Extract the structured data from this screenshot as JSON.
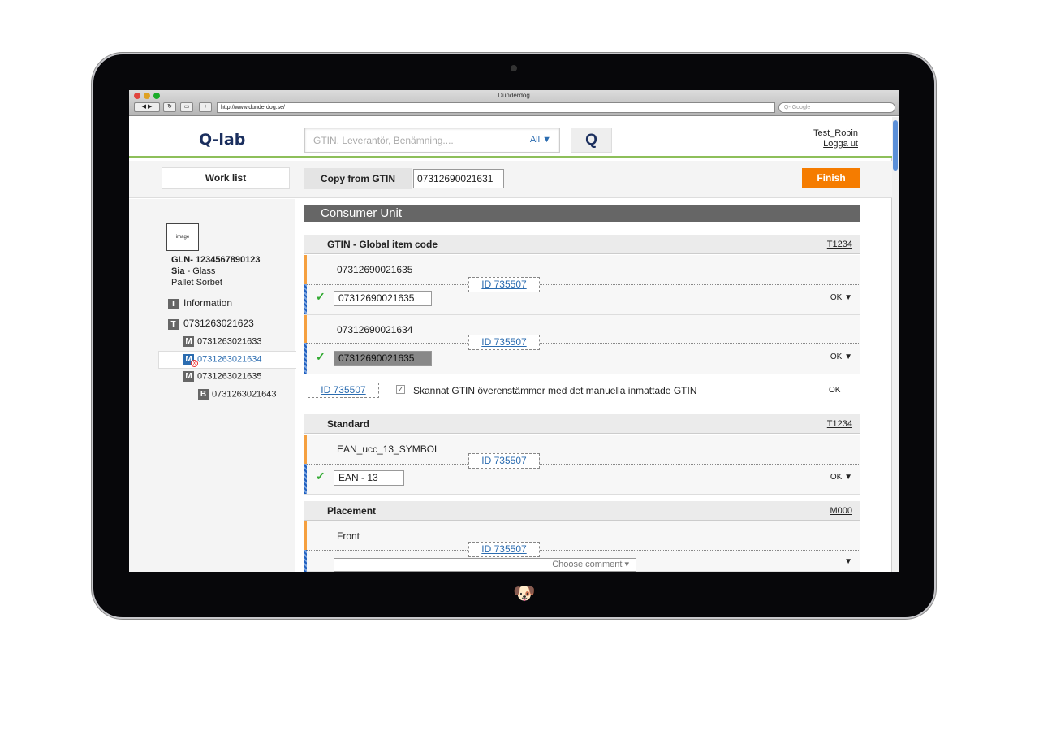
{
  "browser": {
    "title": "Dunderdog",
    "url": "http://www.dunderdog.se/",
    "search_placeholder": "Q- Google"
  },
  "header": {
    "logo": "Q-lab",
    "search_placeholder": "GTIN, Leverantör, Benämning....",
    "filter": "All ▼",
    "search_button": "Q",
    "user": "Test_Robin",
    "logout": "Logga ut"
  },
  "toolbar": {
    "worklist": "Work list",
    "copy_label": "Copy from GTIN",
    "copy_value": "07312690021631",
    "finish": "Finish"
  },
  "sidebar": {
    "image": "image",
    "gln": "GLN- 1234567890123",
    "supplier_bold": "Sia",
    "supplier_rest": " - Glass",
    "product": "Pallet Sorbet",
    "items": [
      {
        "badge": "I",
        "label": "Information"
      },
      {
        "badge": "T",
        "label": "0731263021623"
      },
      {
        "badge": "M",
        "label": "0731263021633"
      },
      {
        "badge": "M",
        "label": "0731263021634",
        "selected": true,
        "error": true
      },
      {
        "badge": "M",
        "label": "0731263021635"
      },
      {
        "badge": "B",
        "label": "0731263021643"
      }
    ]
  },
  "main": {
    "unit_title": "Consumer Unit",
    "gtin": {
      "title": "GTIN - Global item code",
      "code": "T1234",
      "rows": [
        {
          "label": "07312690021635",
          "id": "ID 735507",
          "value": "07312690021635",
          "status": "OK ▼"
        },
        {
          "label": "07312690021634",
          "id": "ID 735507",
          "value": "07312690021635",
          "status": "OK ▼"
        }
      ],
      "check": {
        "id": "ID 735507",
        "text": "Skannat GTIN överenstämmer med det manuella inmattade GTIN",
        "status": "OK",
        "checked": true
      }
    },
    "standard": {
      "title": "Standard",
      "code": "T1234",
      "label": "EAN_ucc_13_SYMBOL",
      "id": "ID 735507",
      "value": "EAN - 13",
      "status": "OK ▼"
    },
    "placement": {
      "title": "Placement",
      "code": "M000",
      "label": "Front",
      "id": "ID 735507",
      "select": "Choose comment",
      "status": "▼"
    }
  },
  "colors": {
    "accent": "#f57c00",
    "green": "#8dbf5a",
    "link": "#2b6cb0",
    "brand": "#1b2f5e"
  }
}
